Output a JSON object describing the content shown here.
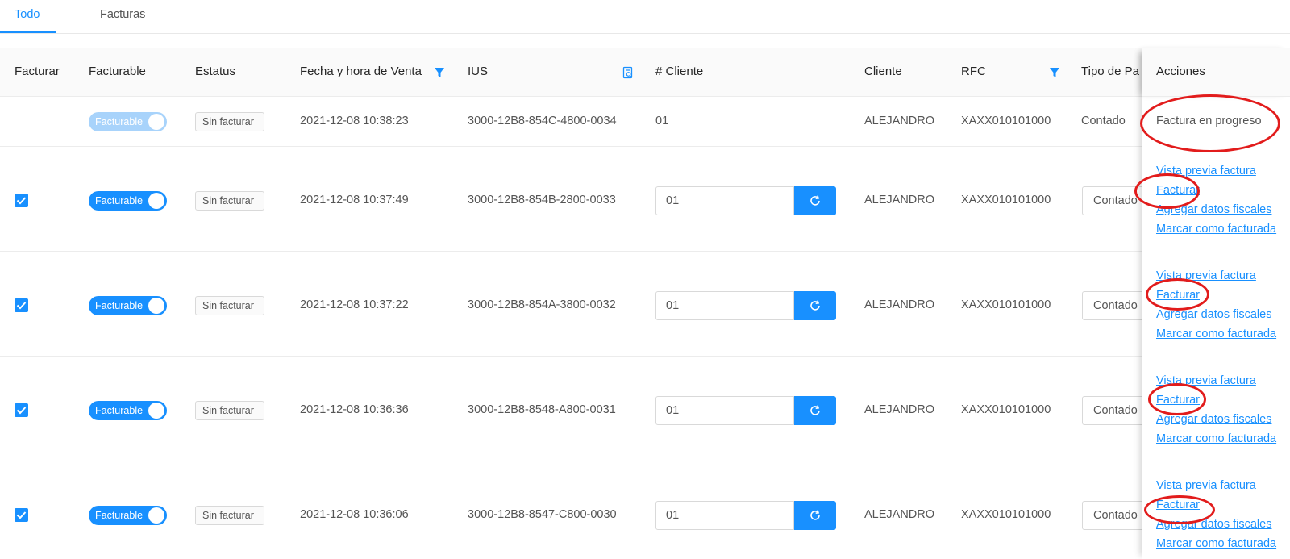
{
  "tabs": [
    {
      "label": "Todo",
      "active": true
    },
    {
      "label": "Facturas",
      "active": false
    }
  ],
  "columns": {
    "facturar": "Facturar",
    "facturable": "Facturable",
    "estatus": "Estatus",
    "fecha": "Fecha y hora de Venta",
    "ius": "IUS",
    "cliente_num": "# Cliente",
    "cliente": "Cliente",
    "rfc": "RFC",
    "tipo_pago": "Tipo de Pa",
    "acciones": "Acciones"
  },
  "rows": [
    {
      "checked": false,
      "facturable_label": "Facturable",
      "facturable_disabled": true,
      "estatus": "Sin facturar",
      "fecha": "2021-12-08 10:38:23",
      "ius": "3000-12B8-854C-4800-0034",
      "cliente_num": "01",
      "cliente": "ALEJANDRO",
      "rfc": "XAXX010101000",
      "tipo_pago": "Contado",
      "accion_texto": "Factura en progreso"
    },
    {
      "checked": true,
      "facturable_label": "Facturable",
      "estatus": "Sin facturar",
      "fecha": "2021-12-08 10:37:49",
      "ius": "3000-12B8-854B-2800-0033",
      "cliente_num": "01",
      "cliente": "ALEJANDRO",
      "rfc": "XAXX010101000",
      "tipo_pago": "Contado",
      "acciones": [
        "Vista previa factura",
        "Facturar",
        "Agregar datos fiscales",
        "Marcar como facturada"
      ]
    },
    {
      "checked": true,
      "facturable_label": "Facturable",
      "estatus": "Sin facturar",
      "fecha": "2021-12-08 10:37:22",
      "ius": "3000-12B8-854A-3800-0032",
      "cliente_num": "01",
      "cliente": "ALEJANDRO",
      "rfc": "XAXX010101000",
      "tipo_pago": "Contado",
      "acciones": [
        "Vista previa factura",
        "Facturar",
        "Agregar datos fiscales",
        "Marcar como facturada"
      ]
    },
    {
      "checked": true,
      "facturable_label": "Facturable",
      "estatus": "Sin facturar",
      "fecha": "2021-12-08 10:36:36",
      "ius": "3000-12B8-8548-A800-0031",
      "cliente_num": "01",
      "cliente": "ALEJANDRO",
      "rfc": "XAXX010101000",
      "tipo_pago": "Contado",
      "acciones": [
        "Vista previa factura",
        "Facturar",
        "Agregar datos fiscales",
        "Marcar como facturada"
      ]
    },
    {
      "checked": true,
      "facturable_label": "Facturable",
      "estatus": "Sin facturar",
      "fecha": "2021-12-08 10:36:06",
      "ius": "3000-12B8-8547-C800-0030",
      "cliente_num": "01",
      "cliente": "ALEJANDRO",
      "rfc": "XAXX010101000",
      "tipo_pago": "Contado",
      "acciones": [
        "Vista previa factura",
        "Facturar",
        "Agregar datos fiscales",
        "Marcar como facturada"
      ]
    }
  ],
  "icons": {
    "fecha_filter": "filter-icon",
    "ius_search": "search-doc-icon",
    "rfc_filter": "filter-icon",
    "refresh": "refresh-icon",
    "check": "check-icon"
  },
  "colors": {
    "accent": "#1890ff",
    "accent_disabled": "#a8d3fb",
    "annotation": "#e21c1c"
  }
}
